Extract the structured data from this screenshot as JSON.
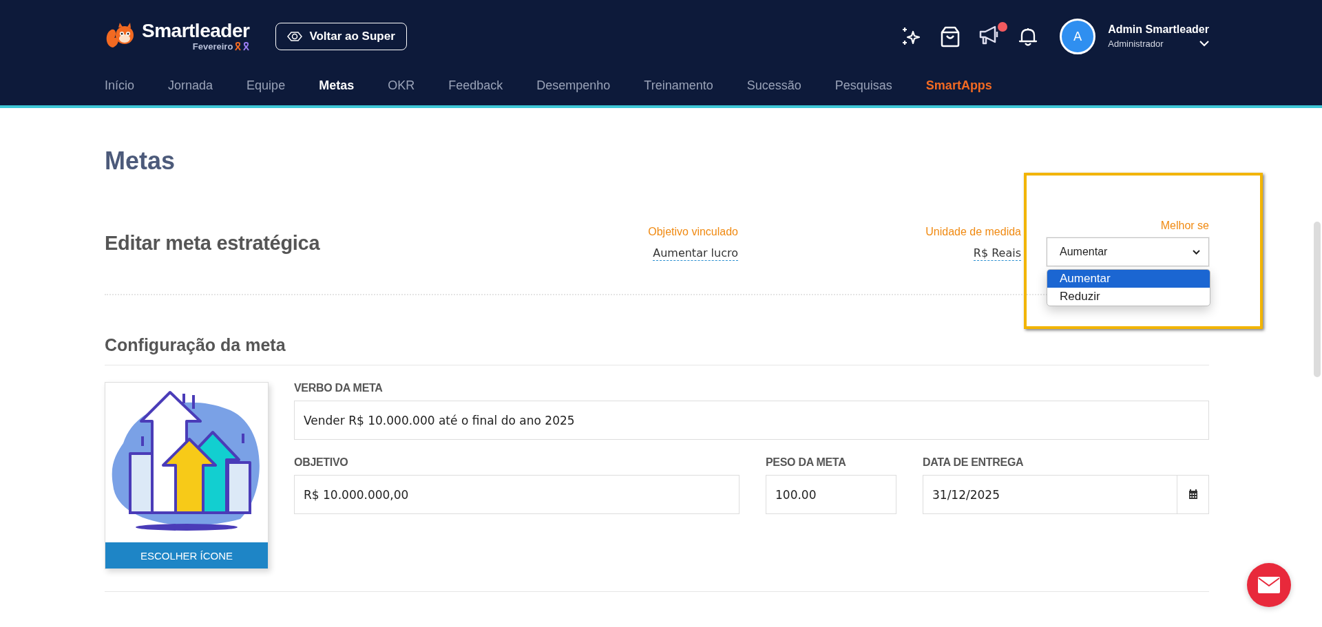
{
  "header": {
    "brand": "Smartleader",
    "month": "Fevereiro",
    "back_button": "Voltar ao Super",
    "announcements_unread": true,
    "user": {
      "avatar": "A",
      "name": "Admin Smartleader",
      "role": "Administrador"
    },
    "nav": [
      {
        "label": "Início",
        "selected": false,
        "kind": "link"
      },
      {
        "label": "Jornada",
        "selected": false,
        "kind": "link"
      },
      {
        "label": "Equipe",
        "selected": false,
        "kind": "link"
      },
      {
        "label": "Metas",
        "selected": true,
        "kind": "link"
      },
      {
        "label": "OKR",
        "selected": false,
        "kind": "link"
      },
      {
        "label": "Feedback",
        "selected": false,
        "kind": "link"
      },
      {
        "label": "Desempenho",
        "selected": false,
        "kind": "link"
      },
      {
        "label": "Treinamento",
        "selected": false,
        "kind": "link"
      },
      {
        "label": "Sucessão",
        "selected": false,
        "kind": "link"
      },
      {
        "label": "Pesquisas",
        "selected": false,
        "kind": "link"
      },
      {
        "label": "SmartApps",
        "selected": false,
        "kind": "featured"
      }
    ]
  },
  "page_title": "Metas",
  "edit": {
    "title": "Editar meta estratégica",
    "fields": [
      {
        "label": "Objetivo vinculado",
        "value": "Aumentar lucro"
      },
      {
        "label": "Unidade de medida",
        "value": "R$ Reais"
      }
    ],
    "better_if": {
      "label": "Melhor se",
      "value": "Aumentar",
      "expanded": true,
      "highlighted": true,
      "options": [
        {
          "label": "Aumentar",
          "selected": true
        },
        {
          "label": "Reduzir",
          "selected": false
        }
      ]
    }
  },
  "config": {
    "title": "Configuração da meta",
    "icon_button": "ESCOLHER ÍCONE",
    "fields": [
      {
        "label": "VERBO DA META",
        "value": "Vender R$ 10.000.000 até o final do ano 2025",
        "kind": "text"
      },
      {
        "label": "OBJETIVO",
        "value": "R$ 10.000.000,00",
        "kind": "text"
      },
      {
        "label": "PESO DA META",
        "value": "100.00",
        "kind": "text"
      },
      {
        "label": "DATA DE ENTREGA",
        "value": "31/12/2025",
        "kind": "date"
      }
    ]
  }
}
